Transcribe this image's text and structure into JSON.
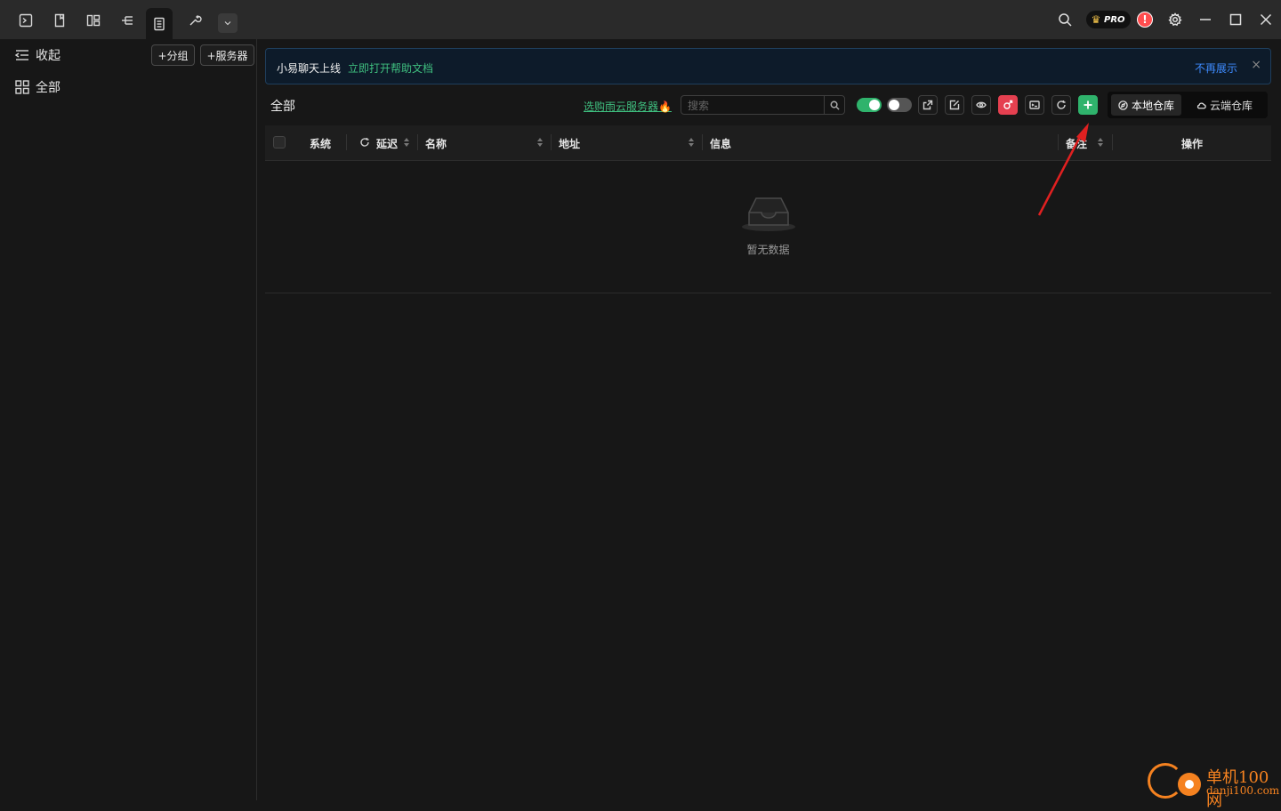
{
  "titlebar": {
    "pro_label": "PRO",
    "alert_label": "!"
  },
  "sidebar": {
    "collapse_label": "收起",
    "all_label": "全部",
    "add_group_label": "+分组",
    "add_server_label": "+服务器"
  },
  "notice": {
    "text": "小易聊天上线",
    "link": "立即打开帮助文档",
    "dismiss": "不再展示",
    "close": "×"
  },
  "toolbar": {
    "section_title": "全部",
    "promo_link": "选购雨云服务器🔥",
    "search_placeholder": "搜索",
    "toggle1_on": true,
    "toggle2_on": false,
    "local_repo_label": "本地仓库",
    "cloud_repo_label": "云端仓库"
  },
  "table": {
    "columns": [
      "系统",
      "延迟",
      "名称",
      "地址",
      "信息",
      "备注",
      "操作"
    ],
    "empty_text": "暂无数据"
  },
  "watermark": {
    "title": "单机100网",
    "subtitle": "danji100.com"
  },
  "colors": {
    "accent_green": "#2fb36c",
    "accent_red": "#e54050",
    "link_blue": "#3e8bff",
    "brand_orange": "#f58220"
  }
}
